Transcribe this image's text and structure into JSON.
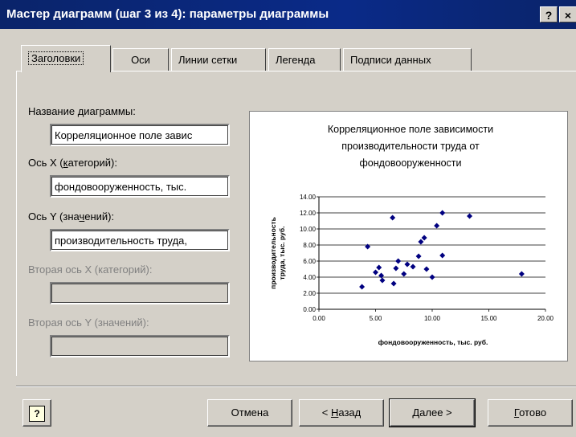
{
  "window": {
    "title": "Мастер диаграмм (шаг 3 из 4): параметры диаграммы",
    "help_button": "?",
    "close_button": "×"
  },
  "tabs": [
    {
      "label": "Заголовки",
      "active": true
    },
    {
      "label": "Оси",
      "active": false
    },
    {
      "label": "Линии сетки",
      "active": false
    },
    {
      "label": "Легенда",
      "active": false
    },
    {
      "label": "Подписи данных",
      "active": false
    }
  ],
  "form": {
    "chart_title_label": "Название диаграммы:",
    "chart_title_value": "Корреляционное поле завис",
    "x_axis_label": "Ось X (категорий):",
    "x_axis_value": "фондовооруженность, тыс.",
    "y_axis_label": "Ось Y (значений):",
    "y_axis_value": "производительность труда,",
    "x2_axis_label": "Вторая ось X (категорий):",
    "x2_axis_value": "",
    "y2_axis_label": "Вторая ось Y (значений):",
    "y2_axis_value": ""
  },
  "buttons": {
    "help": "?",
    "cancel": "Отмена",
    "back": "< Назад",
    "next": "Далее >",
    "finish": "Готово"
  },
  "chart_data": {
    "type": "scatter",
    "title": "Корреляционное поле зависимости производительности труда от фондовооруженности",
    "title_lines": [
      "Корреляционное поле зависимости",
      "производительности труда от",
      "фондовооруженности"
    ],
    "xlabel": "фондовооруженность, тыс. руб.",
    "ylabel": "производительность труда, тыс. руб.",
    "ylabel_lines": [
      "производительность",
      "труда, тыс. руб."
    ],
    "xlim": [
      0,
      20
    ],
    "ylim": [
      0,
      14
    ],
    "xticks": [
      "0.00",
      "5.00",
      "10.00",
      "15.00",
      "20.00"
    ],
    "yticks": [
      "0.00",
      "2.00",
      "4.00",
      "6.00",
      "8.00",
      "10.00",
      "12.00",
      "14.00"
    ],
    "grid": "horizontal",
    "marker_color": "#000080",
    "points": [
      {
        "x": 3.8,
        "y": 2.8
      },
      {
        "x": 4.3,
        "y": 7.8
      },
      {
        "x": 5.0,
        "y": 4.6
      },
      {
        "x": 5.3,
        "y": 5.2
      },
      {
        "x": 5.6,
        "y": 3.6
      },
      {
        "x": 5.5,
        "y": 4.2
      },
      {
        "x": 6.5,
        "y": 11.4
      },
      {
        "x": 6.6,
        "y": 3.2
      },
      {
        "x": 6.8,
        "y": 5.1
      },
      {
        "x": 7.0,
        "y": 6.0
      },
      {
        "x": 7.5,
        "y": 4.4
      },
      {
        "x": 7.8,
        "y": 5.6
      },
      {
        "x": 8.3,
        "y": 5.3
      },
      {
        "x": 8.8,
        "y": 6.6
      },
      {
        "x": 9.0,
        "y": 8.4
      },
      {
        "x": 9.3,
        "y": 8.9
      },
      {
        "x": 9.5,
        "y": 5.0
      },
      {
        "x": 10.0,
        "y": 4.0
      },
      {
        "x": 10.4,
        "y": 10.4
      },
      {
        "x": 10.9,
        "y": 12.0
      },
      {
        "x": 10.9,
        "y": 6.7
      },
      {
        "x": 13.3,
        "y": 11.6
      },
      {
        "x": 17.9,
        "y": 4.4
      }
    ]
  }
}
